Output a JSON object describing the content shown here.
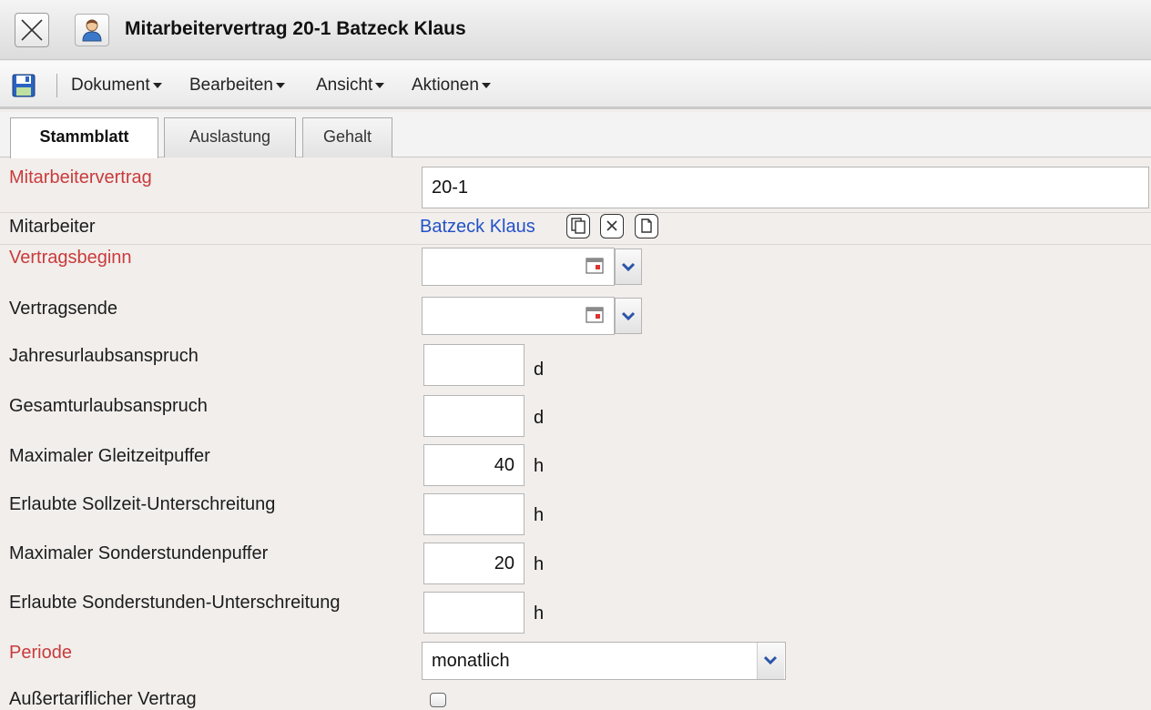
{
  "window": {
    "title": "Mitarbeitervertrag 20-1 Batzeck Klaus",
    "close_icon": "close-icon",
    "user_icon": "user-icon"
  },
  "menubar": {
    "save_icon": "save-icon",
    "items": [
      "Dokument",
      "Bearbeiten",
      "Ansicht",
      "Aktionen"
    ]
  },
  "tabs": [
    "Stammblatt",
    "Auslastung",
    "Gehalt"
  ],
  "colors": {
    "required_label": "#c93b3b",
    "link": "#2352c8",
    "background": "#f1eeec"
  },
  "form": {
    "mitarbeitervertrag": {
      "label": "Mitarbeitervertrag",
      "value": "20-1"
    },
    "mitarbeiter": {
      "label": "Mitarbeiter",
      "value": "Batzeck Klaus"
    },
    "vertragsbeginn": {
      "label": "Vertragsbeginn",
      "value": ""
    },
    "vertragsende": {
      "label": "Vertragsende",
      "value": ""
    },
    "jahresurlaub": {
      "label": "Jahresurlaubsanspruch",
      "value": "",
      "unit": "d"
    },
    "gesamturlaub": {
      "label": "Gesamturlaubsanspruch",
      "value": "",
      "unit": "d"
    },
    "gleitzeitpuffer": {
      "label": "Maximaler Gleitzeitpuffer",
      "value": "40",
      "unit": "h"
    },
    "sollzeit": {
      "label": "Erlaubte Sollzeit-Unterschreitung",
      "value": "",
      "unit": "h"
    },
    "sonderstundenpuffer": {
      "label": "Maximaler Sonderstundenpuffer",
      "value": "20",
      "unit": "h"
    },
    "sonderstunden_unter": {
      "label": "Erlaubte Sonderstunden-Unterschreitung",
      "value": "",
      "unit": "h"
    },
    "periode": {
      "label": "Periode",
      "value": "monatlich"
    },
    "aussertariflich": {
      "label": "Außertariflicher Vertrag",
      "checked": false
    }
  }
}
